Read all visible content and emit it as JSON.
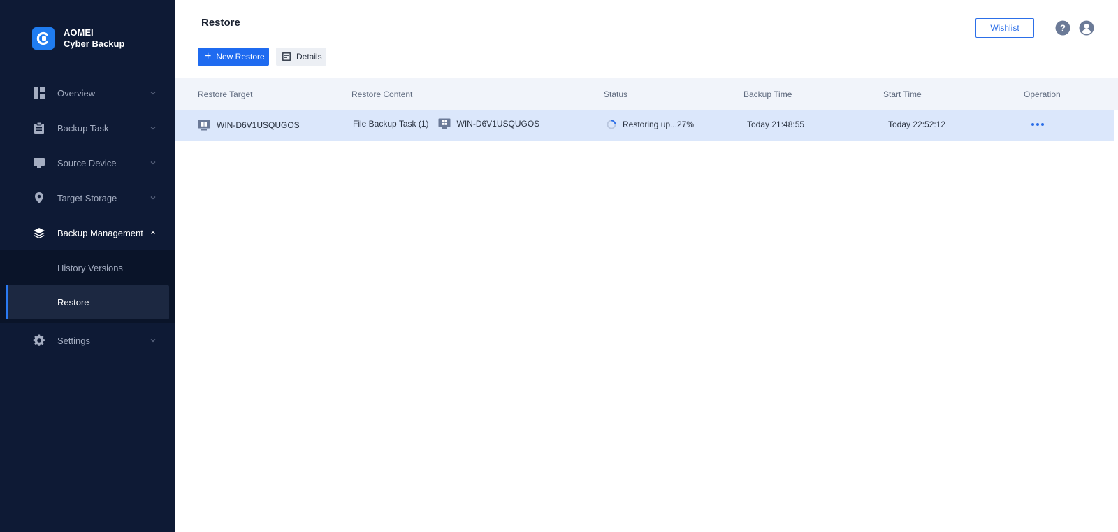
{
  "app": {
    "logo_line1": "AOMEI",
    "logo_line2": "Cyber Backup",
    "accent": "#1f6bf0",
    "sidebar_bg": "#0e1a35"
  },
  "sidebar": {
    "items": [
      {
        "label": "Overview",
        "icon": "dashboard-icon"
      },
      {
        "label": "Backup Task",
        "icon": "clipboard-icon"
      },
      {
        "label": "Source Device",
        "icon": "monitor-icon"
      },
      {
        "label": "Target Storage",
        "icon": "location-pin-icon"
      },
      {
        "label": "Backup Management",
        "icon": "layers-icon",
        "expanded": true
      },
      {
        "label": "Settings",
        "icon": "gear-icon"
      }
    ],
    "sub_items": [
      {
        "label": "History Versions"
      },
      {
        "label": "Restore",
        "selected": true
      }
    ]
  },
  "header": {
    "title": "Restore",
    "new_restore_label": "New Restore",
    "details_label": "Details",
    "wishlist_label": "Wishlist"
  },
  "table": {
    "columns": [
      "Restore Target",
      "Restore Content",
      "Status",
      "Backup Time",
      "Start Time",
      "Operation"
    ],
    "rows": [
      {
        "restore_target": "WIN-D6V1USQUGOS",
        "content_task": "File Backup Task (1)",
        "content_device": "WIN-D6V1USQUGOS",
        "status": "Restoring up...27%",
        "backup_time": "Today 21:48:55",
        "start_time": "Today 22:52:12"
      }
    ]
  }
}
